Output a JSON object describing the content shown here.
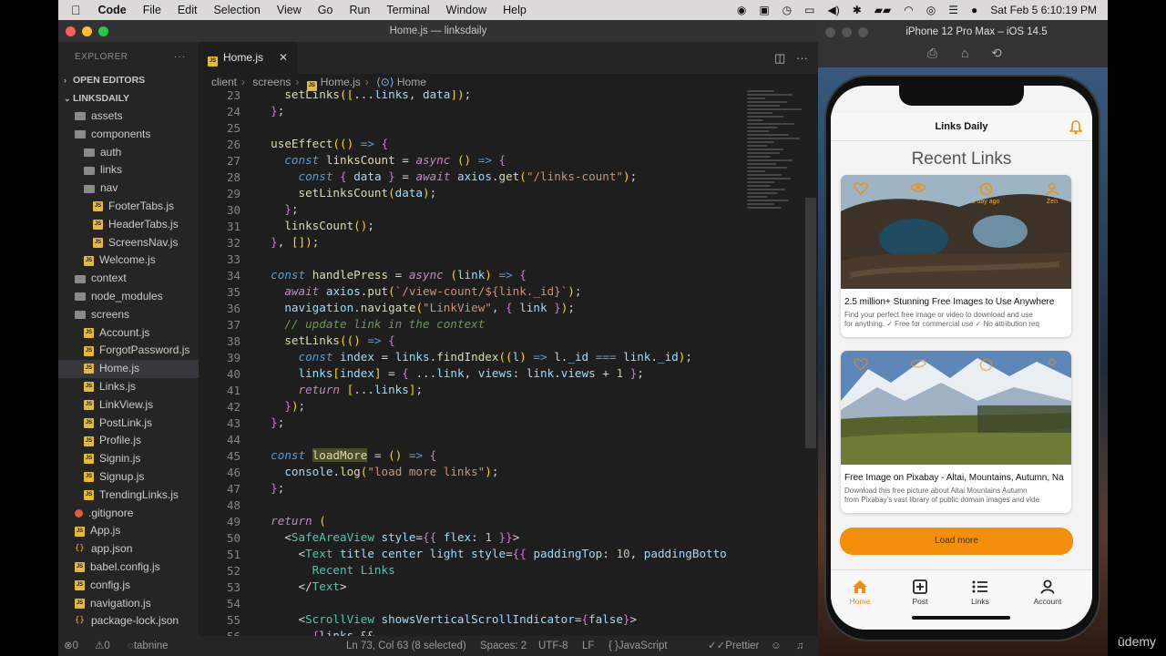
{
  "menubar": {
    "app": "Code",
    "items": [
      "File",
      "Edit",
      "Selection",
      "View",
      "Go",
      "Run",
      "Terminal",
      "Window",
      "Help"
    ],
    "clock": "Sat Feb 5  6:10:19 PM"
  },
  "window": {
    "title": "Home.js — linksdaily"
  },
  "explorer": {
    "title": "EXPLORER",
    "open_editors": "OPEN EDITORS",
    "project": "LINKSDAILY",
    "tree": [
      {
        "label": "assets",
        "type": "folder",
        "indent": 1
      },
      {
        "label": "components",
        "type": "folder",
        "indent": 1
      },
      {
        "label": "auth",
        "type": "folder",
        "indent": 2
      },
      {
        "label": "links",
        "type": "folder",
        "indent": 2
      },
      {
        "label": "nav",
        "type": "folder",
        "indent": 2
      },
      {
        "label": "FooterTabs.js",
        "type": "js",
        "indent": 3
      },
      {
        "label": "HeaderTabs.js",
        "type": "js",
        "indent": 3
      },
      {
        "label": "ScreensNav.js",
        "type": "js",
        "indent": 3
      },
      {
        "label": "Welcome.js",
        "type": "js",
        "indent": 2
      },
      {
        "label": "context",
        "type": "folder",
        "indent": 1
      },
      {
        "label": "node_modules",
        "type": "folder",
        "indent": 1
      },
      {
        "label": "screens",
        "type": "folder",
        "indent": 1
      },
      {
        "label": "Account.js",
        "type": "js",
        "indent": 2
      },
      {
        "label": "ForgotPassword.js",
        "type": "js",
        "indent": 2
      },
      {
        "label": "Home.js",
        "type": "js",
        "indent": 2,
        "selected": true
      },
      {
        "label": "Links.js",
        "type": "js",
        "indent": 2
      },
      {
        "label": "LinkView.js",
        "type": "js",
        "indent": 2
      },
      {
        "label": "PostLink.js",
        "type": "js",
        "indent": 2
      },
      {
        "label": "Profile.js",
        "type": "js",
        "indent": 2
      },
      {
        "label": "Signin.js",
        "type": "js",
        "indent": 2
      },
      {
        "label": "Signup.js",
        "type": "js",
        "indent": 2
      },
      {
        "label": "TrendingLinks.js",
        "type": "js",
        "indent": 2
      },
      {
        "label": ".gitignore",
        "type": "git",
        "indent": 1
      },
      {
        "label": "App.js",
        "type": "js",
        "indent": 1
      },
      {
        "label": "app.json",
        "type": "json",
        "indent": 1
      },
      {
        "label": "babel.config.js",
        "type": "js",
        "indent": 1
      },
      {
        "label": "config.js",
        "type": "js",
        "indent": 1
      },
      {
        "label": "navigation.js",
        "type": "js",
        "indent": 1
      },
      {
        "label": "package-lock.json",
        "type": "json",
        "indent": 1
      }
    ]
  },
  "editor": {
    "tab": "Home.js",
    "breadcrumb": [
      "client",
      "screens",
      "Home.js",
      "Home"
    ],
    "line_numbers": [
      "23",
      "24",
      "25",
      "26",
      "27",
      "28",
      "29",
      "30",
      "31",
      "32",
      "33",
      "34",
      "35",
      "36",
      "37",
      "38",
      "39",
      "40",
      "41",
      "42",
      "43",
      "44",
      "45",
      "46",
      "47",
      "48",
      "49",
      "50",
      "51",
      "52",
      "53",
      "54",
      "55",
      "56"
    ],
    "code": [
      "    setLinks([...links, data]);",
      "  };",
      "",
      "  useEffect(() => {",
      "    const linksCount = async () => {",
      "      const { data } = await axios.get(\"/links-count\");",
      "      setLinksCount(data);",
      "    };",
      "    linksCount();",
      "  }, []);",
      "",
      "  const handlePress = async (link) => {",
      "    await axios.put(`/view-count/${link._id}`);",
      "    navigation.navigate(\"LinkView\", { link });",
      "    // update link in the context",
      "    setLinks(() => {",
      "      const index = links.findIndex((l) => l._id === link._id);",
      "      links[index] = { ...link, views: link.views + 1 };",
      "      return [...links];",
      "    });",
      "  };",
      "",
      "  const loadMore = () => {",
      "    console.log(\"load more links\");",
      "  };",
      "",
      "  return (",
      "    <SafeAreaView style={{ flex: 1 }}>",
      "      <Text title center light style={{ paddingTop: 10, paddingBotto",
      "        Recent Links",
      "      </Text>",
      "",
      "      <ScrollView showsVerticalScrollIndicator={false}>",
      "        {links &&"
    ]
  },
  "status": {
    "problems": "0",
    "warnings": "0",
    "tabnine": "tabnine",
    "position": "Ln 73, Col 63 (8 selected)",
    "spaces": "Spaces: 2",
    "encoding": "UTF-8",
    "eol": "LF",
    "language": "JavaScript",
    "formatter": "Prettier"
  },
  "simulator": {
    "title": "iPhone 12 Pro Max – iOS 14.5",
    "app": {
      "header": "Links Daily",
      "heading": "Recent Links",
      "cards": [
        {
          "title": "2.5 million+ Stunning Free Images to Use Anywhere",
          "desc1": "Find your perfect free image or video to download and use",
          "desc2": "for anything. ✓ Free for commercial use ✓ No attribution req",
          "stats": [
            "0",
            "1",
            "a day ago",
            "Zen"
          ]
        },
        {
          "title": "Free Image on Pixabay - Altai, Mountains, Autumn, Na",
          "desc1": "Download this free picture about Altai Mountains Autumn",
          "desc2": "from Pixabay's vast library of public domain images and vide",
          "stats": [
            "",
            "",
            "",
            ""
          ]
        }
      ],
      "load_more": "Load more",
      "tabs": [
        "Home",
        "Post",
        "Links",
        "Account"
      ],
      "accent": "#f48f0c"
    }
  },
  "udemy": "ūdemy"
}
